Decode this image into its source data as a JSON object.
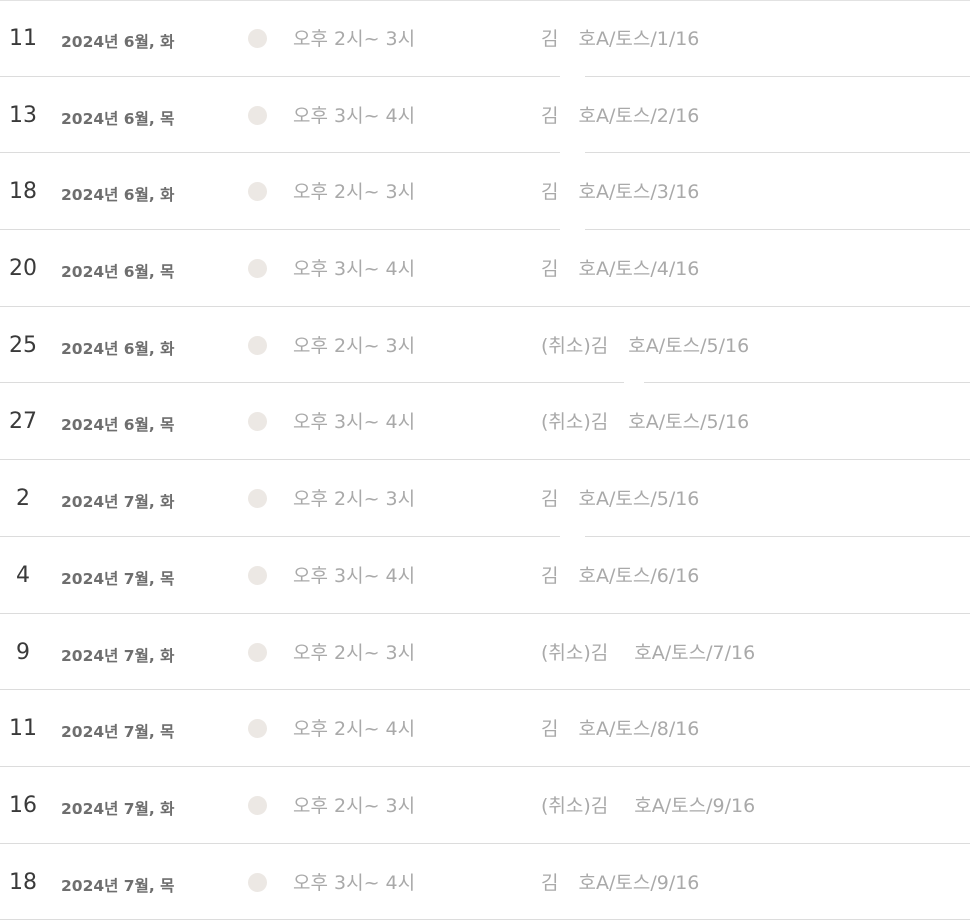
{
  "events": [
    {
      "day": "11",
      "date": "2024년 6월, 화",
      "time": "오후 2시~ 3시",
      "name": "김",
      "title": "호A/토스/1/16"
    },
    {
      "day": "13",
      "date": "2024년 6월, 목",
      "time": "오후 3시~ 4시",
      "name": "김",
      "title": "호A/토스/2/16"
    },
    {
      "day": "18",
      "date": "2024년 6월, 화",
      "time": "오후 2시~ 3시",
      "name": "김",
      "title": "호A/토스/3/16"
    },
    {
      "day": "20",
      "date": "2024년 6월, 목",
      "time": "오후 3시~ 4시",
      "name": "김",
      "title": "호A/토스/4/16"
    },
    {
      "day": "25",
      "date": "2024년 6월, 화",
      "time": "오후 2시~ 3시",
      "name": "(취소)김",
      "title": "호A/토스/5/16"
    },
    {
      "day": "27",
      "date": "2024년 6월, 목",
      "time": "오후 3시~ 4시",
      "name": "(취소)김",
      "title": "호A/토스/5/16"
    },
    {
      "day": "2",
      "date": "2024년 7월, 화",
      "time": "오후 2시~ 3시",
      "name": "김",
      "title": "호A/토스/5/16"
    },
    {
      "day": "4",
      "date": "2024년 7월, 목",
      "time": "오후 3시~ 4시",
      "name": "김",
      "title": "호A/토스/6/16"
    },
    {
      "day": "9",
      "date": "2024년 7월, 화",
      "time": "오후 2시~ 3시",
      "name": "(취소)김",
      "title": "호A/토스/7/16"
    },
    {
      "day": "11",
      "date": "2024년 7월, 목",
      "time": "오후 2시~ 4시",
      "name": "김",
      "title": "호A/토스/8/16"
    },
    {
      "day": "16",
      "date": "2024년 7월, 화",
      "time": "오후 2시~ 3시",
      "name": "(취소)김",
      "title": "호A/토스/9/16"
    },
    {
      "day": "18",
      "date": "2024년 7월, 목",
      "time": "오후 3시~ 4시",
      "name": "김",
      "title": "호A/토스/9/16"
    }
  ],
  "colors": {
    "day_text": "#3a3a3a",
    "date_text": "#6e6e6e",
    "muted_text": "#a9a9a9",
    "dot": "#ece8e4",
    "divider": "#dcdcdc"
  }
}
